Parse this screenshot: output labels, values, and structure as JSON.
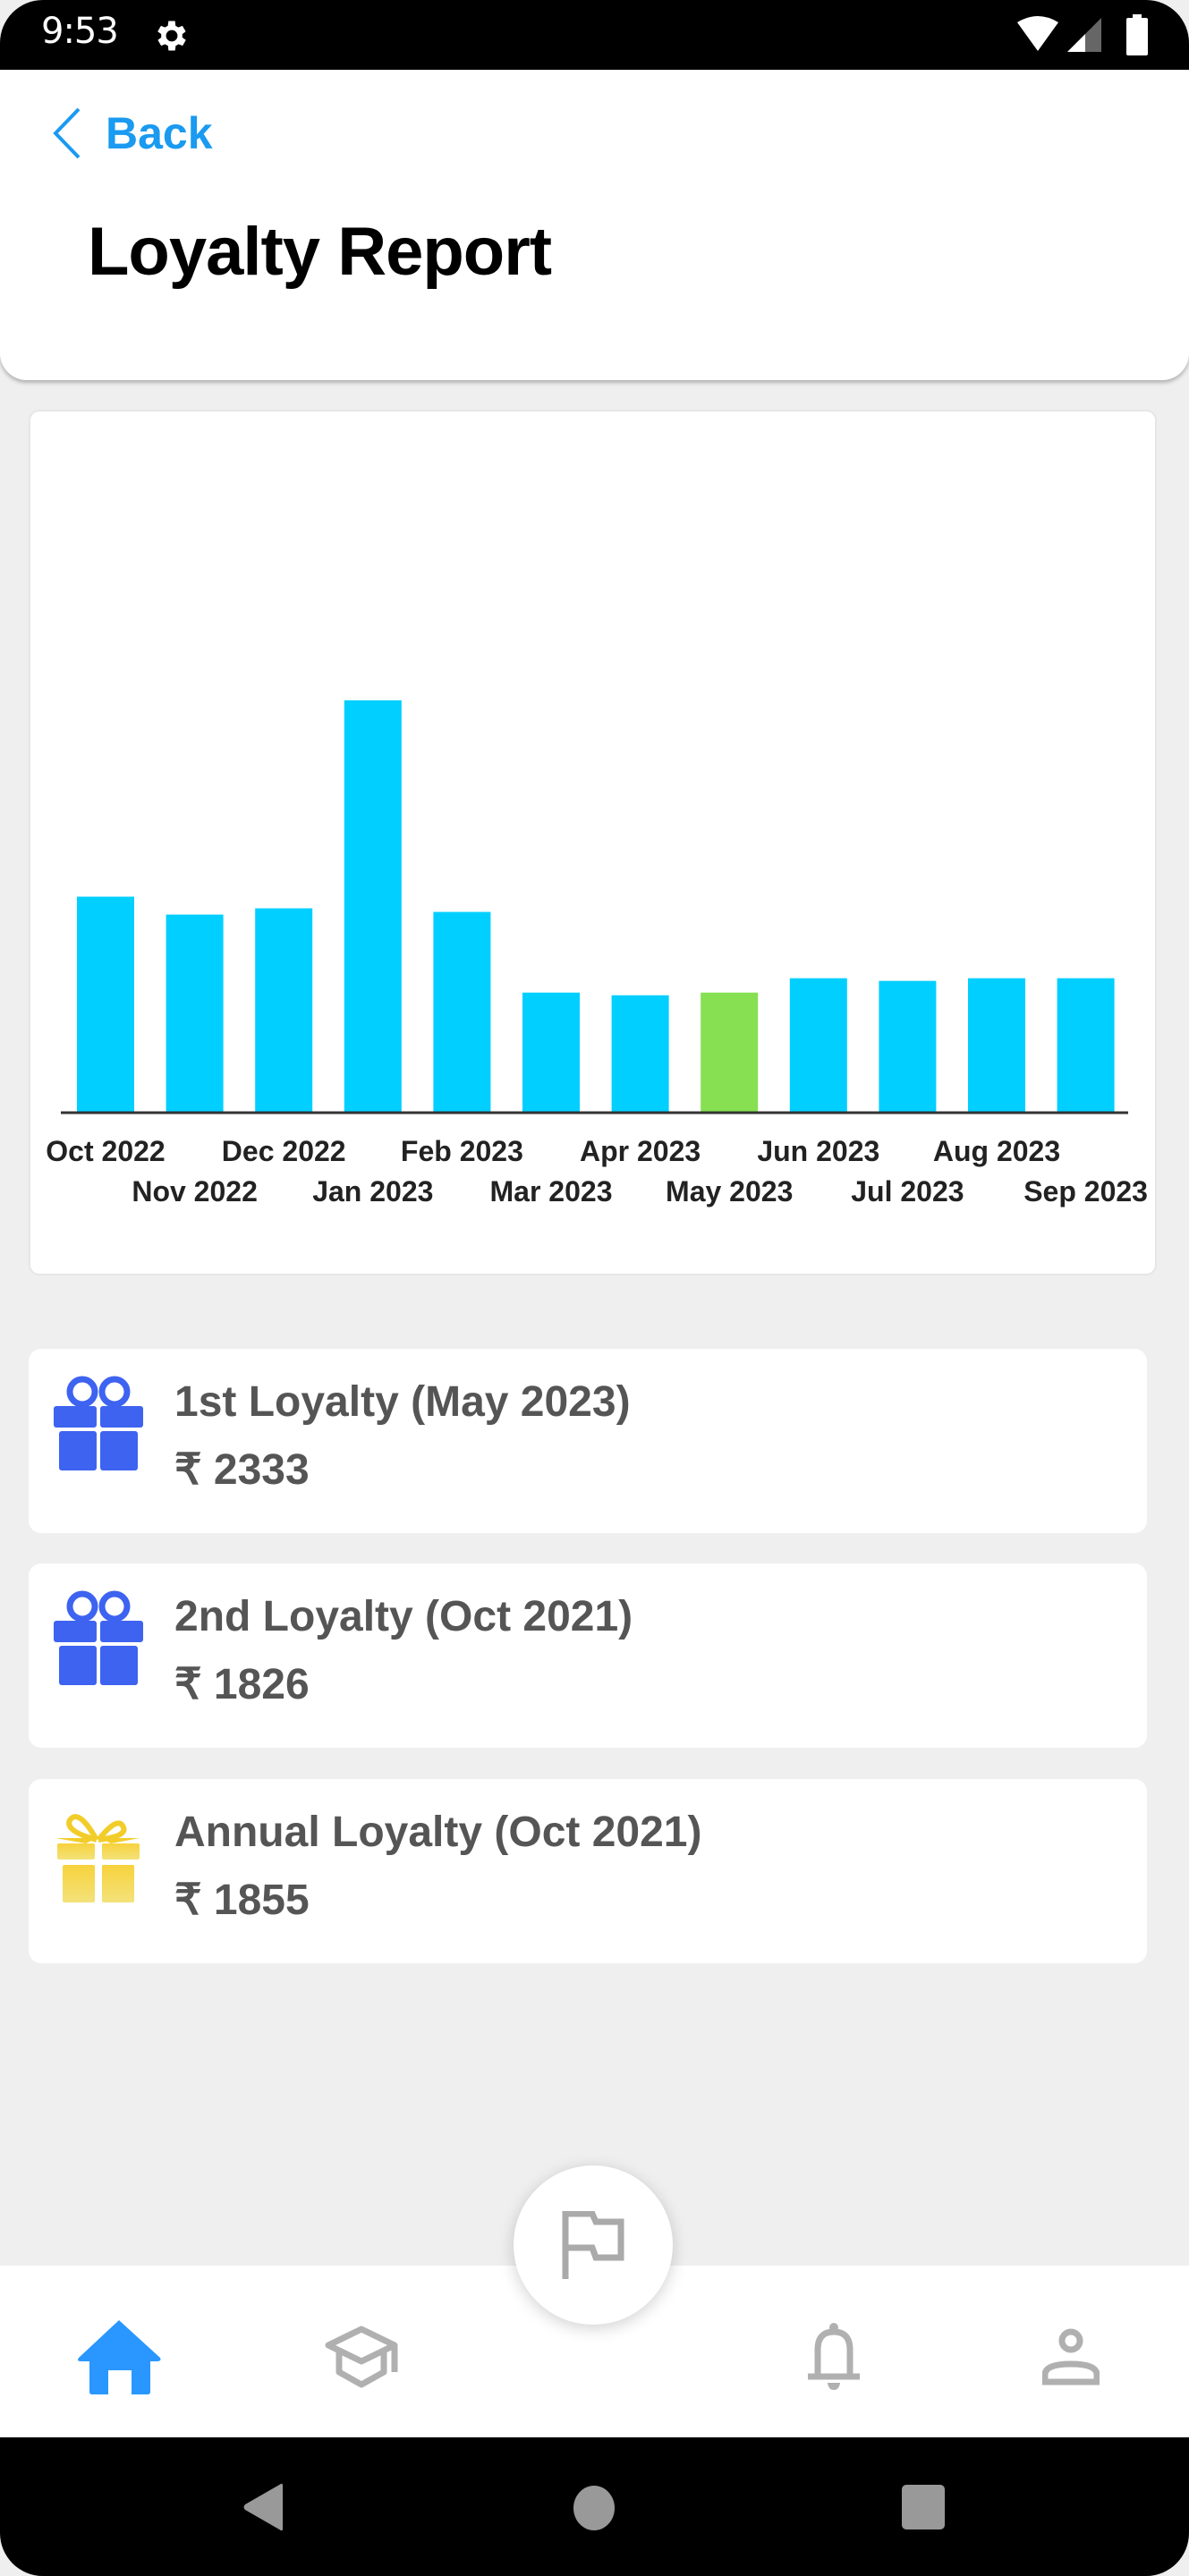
{
  "status_bar": {
    "time": "9:53",
    "icons": [
      "settings-gear-icon",
      "wifi-icon",
      "signal-icon",
      "battery-icon"
    ]
  },
  "header": {
    "back_label": "Back",
    "title": "Loyalty Report"
  },
  "colors": {
    "accent": "#1a9af0",
    "bar_default": "#00cfff",
    "bar_highlight": "#86e052",
    "gift_blue": "#3d63f0",
    "gift_gold": "#f5cf1a",
    "nav_active": "#2997ff",
    "nav_inactive": "#b0b0b0"
  },
  "chart_data": {
    "type": "bar",
    "title": "",
    "xlabel": "",
    "ylabel": "",
    "grid": false,
    "legend": "none",
    "categories": [
      "Oct 2022",
      "Nov 2022",
      "Dec 2022",
      "Jan 2023",
      "Feb 2023",
      "Mar 2023",
      "Apr 2023",
      "May 2023",
      "Jun 2023",
      "Jul 2023",
      "Aug 2023",
      "Sep 2023"
    ],
    "values": [
      4196,
      3848,
      3970,
      8010,
      3900,
      2333,
      2281,
      2333,
      2612,
      2560,
      2612,
      2612
    ],
    "highlight_category": "May 2023",
    "ylim": [
      0,
      8010
    ],
    "note": "No y-axis shown; values estimated from relative bar heights scaled so May 2023 = 2333"
  },
  "loyalty_items": [
    {
      "title": "1st Loyalty (May 2023)",
      "amount": "₹ 2333",
      "icon": "gift-icon",
      "icon_color": "blue"
    },
    {
      "title": "2nd Loyalty (Oct 2021)",
      "amount": "₹ 1826",
      "icon": "gift-icon",
      "icon_color": "blue"
    },
    {
      "title": "Annual Loyalty (Oct 2021)",
      "amount": "₹ 1855",
      "icon": "gift-icon",
      "icon_color": "gold"
    }
  ],
  "bottom_nav": {
    "items": [
      {
        "name": "home",
        "icon": "home-icon",
        "active": true
      },
      {
        "name": "learn",
        "icon": "school-icon",
        "active": false
      },
      {
        "name": "report",
        "icon": "flag-icon",
        "active": false,
        "fab": true
      },
      {
        "name": "notifications",
        "icon": "bell-icon",
        "active": false
      },
      {
        "name": "profile",
        "icon": "person-icon",
        "active": false
      }
    ]
  },
  "system_nav": [
    "back",
    "home",
    "recents"
  ]
}
